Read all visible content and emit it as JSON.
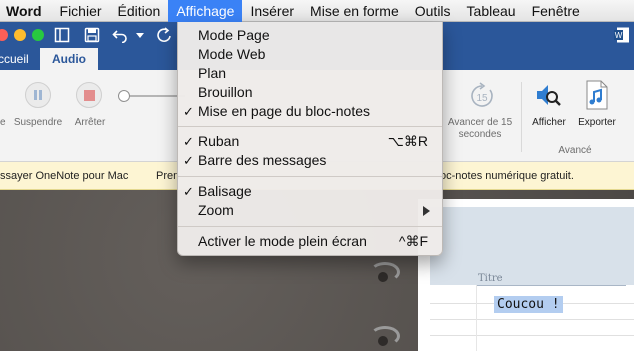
{
  "menubar": {
    "app": "Word",
    "items": [
      "Fichier",
      "Édition",
      "Affichage",
      "Insérer",
      "Mise en forme",
      "Outils",
      "Tableau",
      "Fenêtre"
    ],
    "active": "Affichage"
  },
  "titlebar": {
    "traffic_lights": [
      "#fd5f57",
      "#febc2e",
      "#28c840"
    ],
    "brand_color": "#2b579a"
  },
  "tabs": {
    "items": [
      "ccueil",
      "Audio"
    ],
    "active": "Audio"
  },
  "ribbon": {
    "suspend_label": "Suspendre",
    "stop_label": "Arrêter",
    "left_partial": "e",
    "forward_label": "Avancer de 15 secondes",
    "forward_badge": "15",
    "show_label": "Afficher",
    "export_label": "Exporter",
    "group_label": "Avancé"
  },
  "message_bar": {
    "left": "ssayer OneNote pour Mac",
    "middle": "Pren",
    "right": "oc-notes numérique gratuit."
  },
  "dropdown": {
    "items": [
      {
        "label": "Mode Page",
        "checked": false,
        "shortcut": ""
      },
      {
        "label": "Mode Web",
        "checked": false,
        "shortcut": ""
      },
      {
        "label": "Plan",
        "checked": false,
        "shortcut": ""
      },
      {
        "label": "Brouillon",
        "checked": false,
        "shortcut": ""
      },
      {
        "label": "Mise en page du bloc-notes",
        "checked": true,
        "shortcut": ""
      },
      {
        "label": "Ruban",
        "checked": true,
        "shortcut": "⌥⌘R"
      },
      {
        "label": "Barre des messages",
        "checked": true,
        "shortcut": ""
      },
      {
        "label": "Balisage",
        "checked": true,
        "shortcut": ""
      },
      {
        "label": "Zoom",
        "checked": false,
        "shortcut": "",
        "submenu": true
      },
      {
        "label": "Activer le mode plein écran",
        "checked": false,
        "shortcut": "^⌘F"
      }
    ],
    "check_glyph": "✓"
  },
  "document": {
    "title_placeholder": "Titre",
    "body_text": "Coucou !"
  }
}
